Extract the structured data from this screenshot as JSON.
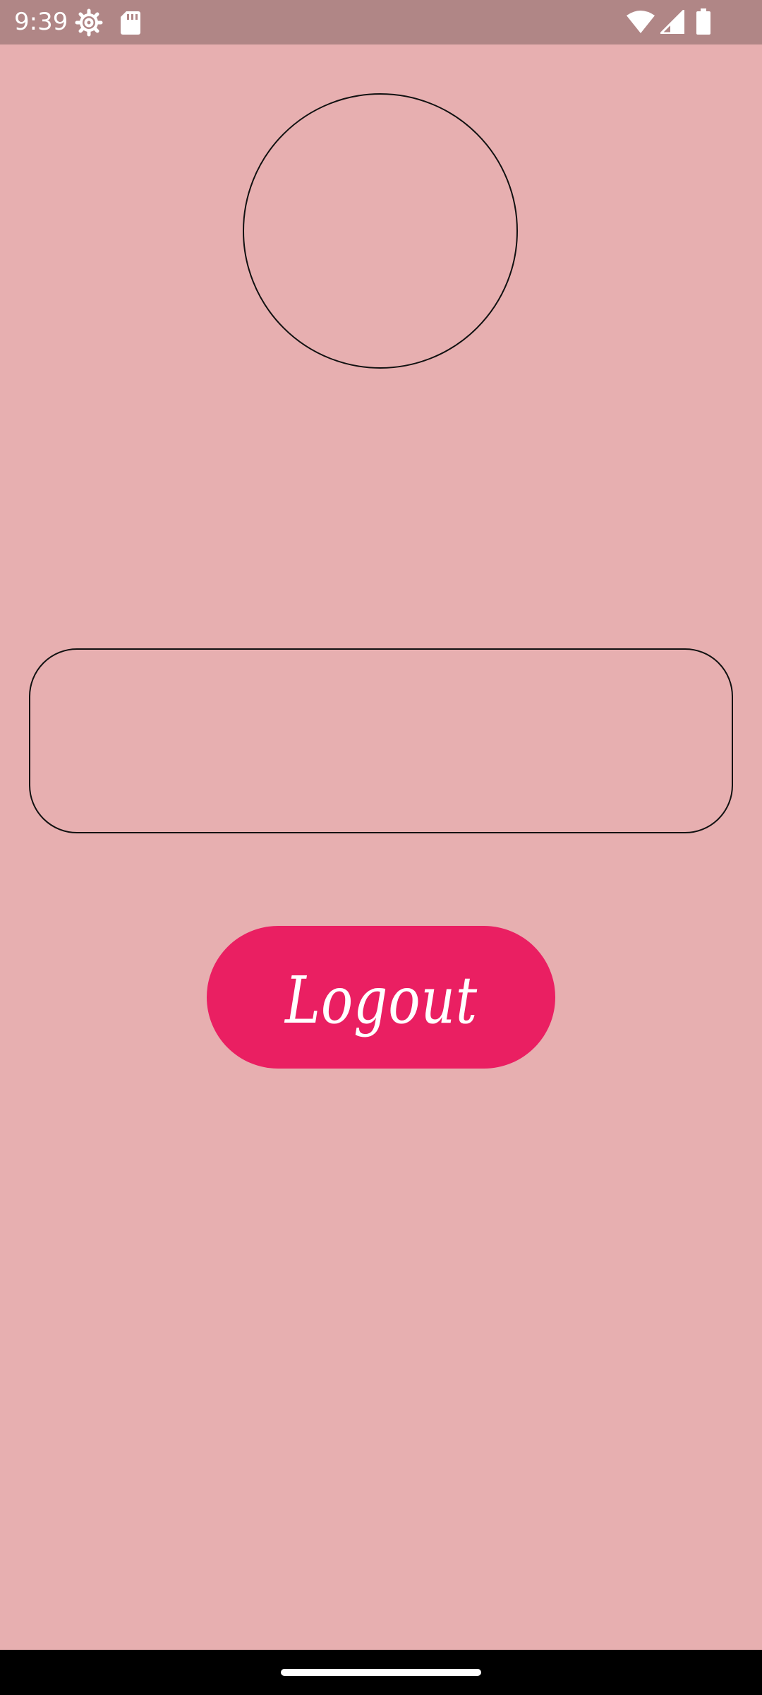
{
  "status_bar": {
    "time": "9:39",
    "icons": [
      "settings-gear-icon",
      "sd-card-icon",
      "wifi-icon",
      "cellular-signal-icon",
      "battery-icon"
    ],
    "background": "#b08686"
  },
  "profile": {
    "avatar": "empty-circle",
    "info_box": ""
  },
  "actions": {
    "logout_label": "Logout",
    "logout_color": "#ea1f62"
  },
  "theme": {
    "background": "#e7afb0"
  }
}
